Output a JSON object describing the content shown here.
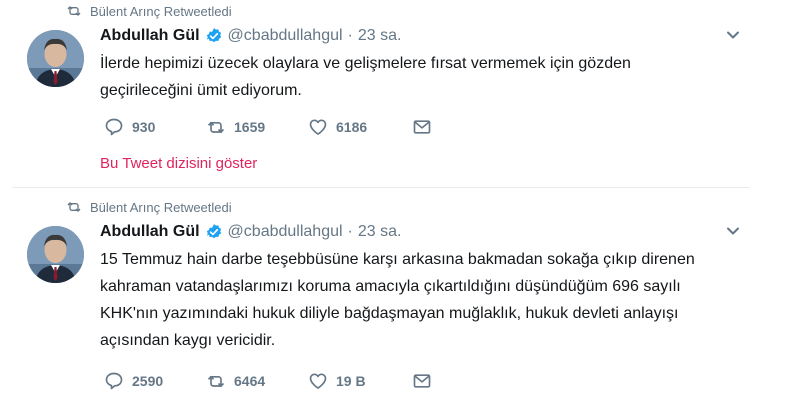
{
  "tweets": [
    {
      "retweeted_by": "Bülent Arınç Retweetledi",
      "author_name": "Abdullah Gül",
      "handle": "@cbabdullahgul",
      "separator": "·",
      "time": "23 sa.",
      "text": "İlerde hepimizi üzecek olaylara ve gelişmelere fırsat vermemek için gözden geçirileceğini ümit ediyorum.",
      "replies": "930",
      "retweets": "1659",
      "likes": "6186",
      "thread_link": "Bu Tweet dizisini göster"
    },
    {
      "retweeted_by": "Bülent Arınç Retweetledi",
      "author_name": "Abdullah Gül",
      "handle": "@cbabdullahgul",
      "separator": "·",
      "time": "23 sa.",
      "text": "15 Temmuz hain darbe teşebbüsüne karşı arkasına bakmadan sokağa çıkıp direnen kahraman vatandaşlarımızı koruma amacıyla çıkartıldığını düşündüğüm 696 sayılı KHK'nın yazımındaki hukuk diliyle bağdaşmayan muğlaklık, hukuk devleti anlayışı açısından kaygı vericidir.",
      "replies": "2590",
      "retweets": "6464",
      "likes": "19 B"
    }
  ],
  "icons": {
    "retweet_context": "retweet-icon",
    "verified": "verified-badge-icon",
    "caret": "chevron-down-icon",
    "reply": "reply-icon",
    "retweet": "retweet-icon",
    "like": "heart-icon",
    "dm": "envelope-icon"
  },
  "colors": {
    "text": "#14171a",
    "muted": "#657786",
    "verified": "#1da1f2",
    "thread_link": "#e0245e",
    "divider": "#e6ecf0"
  }
}
